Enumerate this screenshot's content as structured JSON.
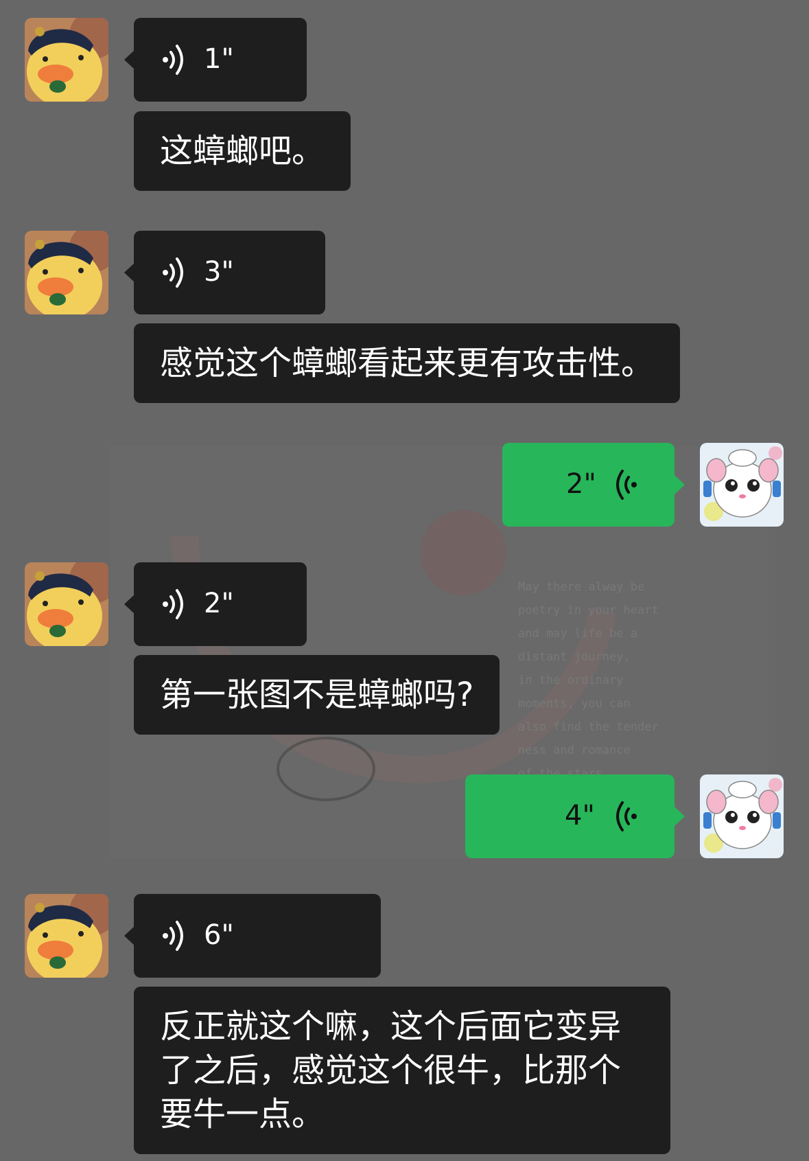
{
  "colors": {
    "background": "#676767",
    "received_bubble": "#1e1e1e",
    "sent_bubble": "#27b65a"
  },
  "wallpaper_text": "May there alway be poetry in your heart and may life be a distant journey, in the ordinary moments, you can also find the tender ness and romance of the stars",
  "messages": [
    {
      "side": "received",
      "type": "voice",
      "duration": "1\""
    },
    {
      "side": "received",
      "type": "text",
      "text": "这蟑螂吧。"
    },
    {
      "side": "received",
      "type": "voice",
      "duration": "3\""
    },
    {
      "side": "received",
      "type": "text",
      "text": "感觉这个蟑螂看起来更有攻击性。"
    },
    {
      "side": "sent",
      "type": "voice",
      "duration": "2\""
    },
    {
      "side": "received",
      "type": "voice",
      "duration": "2\""
    },
    {
      "side": "received",
      "type": "text",
      "text": "第一张图不是蟑螂吗?"
    },
    {
      "side": "sent",
      "type": "voice",
      "duration": "4\""
    },
    {
      "side": "received",
      "type": "voice",
      "duration": "6\""
    },
    {
      "side": "received",
      "type": "text",
      "text": "反正就这个嘛，这个后面它变异了之后，感觉这个很牛，比那个要牛一点。"
    }
  ]
}
